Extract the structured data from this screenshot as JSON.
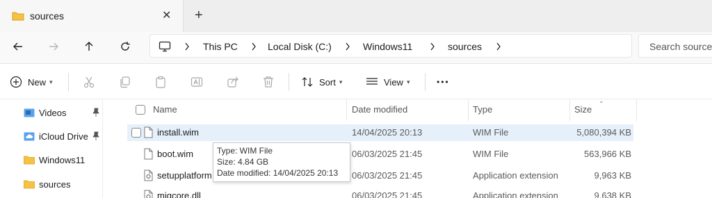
{
  "tab": {
    "title": "sources",
    "close": "✕",
    "new_tab": "+"
  },
  "breadcrumbs": [
    "This PC",
    "Local Disk (C:)",
    "Windows11",
    "sources"
  ],
  "search": {
    "placeholder": "Search sources"
  },
  "toolbar": {
    "new_label": "New",
    "sort_label": "Sort",
    "view_label": "View",
    "more_label": "•••"
  },
  "sidebar": {
    "items": [
      {
        "label": "Videos",
        "icon": "videos-folder-icon",
        "pinned": true
      },
      {
        "label": "iCloud Drive",
        "icon": "icloud-folder-icon",
        "pinned": true
      },
      {
        "label": "Windows11",
        "icon": "folder-icon",
        "pinned": false
      },
      {
        "label": "sources",
        "icon": "folder-icon",
        "pinned": false
      }
    ]
  },
  "columns": {
    "name": "Name",
    "date": "Date modified",
    "type": "Type",
    "size": "Size"
  },
  "files": [
    {
      "name": "install.wim",
      "date": "14/04/2025 20:13",
      "type": "WIM File",
      "size": "5,080,394 KB",
      "selected": true
    },
    {
      "name": "boot.wim",
      "date": "06/03/2025 21:45",
      "type": "WIM File",
      "size": "563,966 KB",
      "selected": false
    },
    {
      "name": "setupplatform",
      "date": "06/03/2025 21:45",
      "type": "Application extension",
      "size": "9,963 KB",
      "selected": false
    },
    {
      "name": "migcore.dll",
      "date": "06/03/2025 21:45",
      "type": "Application extension",
      "size": "9,638 KB",
      "selected": false
    }
  ],
  "tooltip": {
    "type_line": "Type: WIM File",
    "size_line": "Size: 4.84 GB",
    "date_line": "Date modified: 14/04/2025 20:13"
  },
  "colors": {
    "folder": "#f5c242",
    "selection": "#e5f0fb",
    "accent": "#0067c0"
  }
}
